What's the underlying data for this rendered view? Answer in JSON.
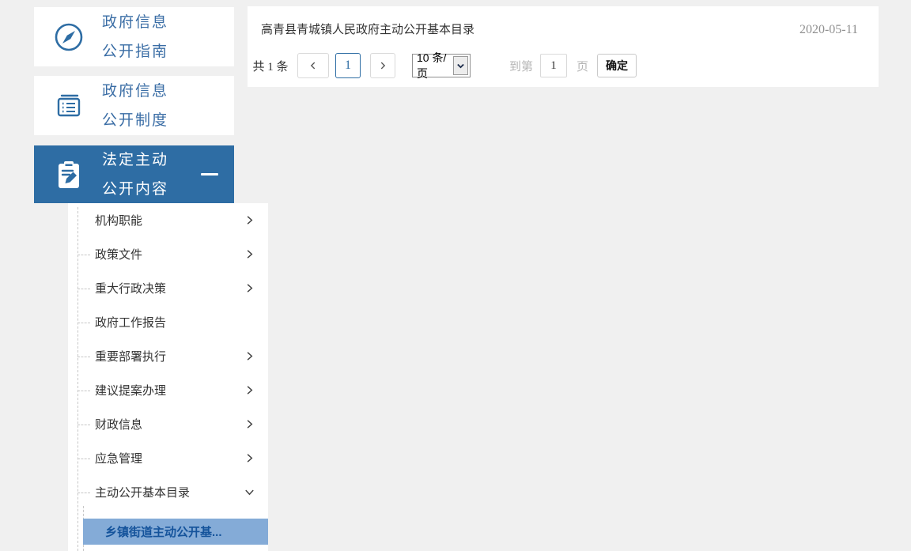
{
  "sidebar": {
    "cards": [
      {
        "icon": "compass-icon",
        "lines": [
          "政府信息",
          "公开指南"
        ],
        "active": false
      },
      {
        "icon": "notebook-icon",
        "lines": [
          "政府信息",
          "公开制度"
        ],
        "active": false
      },
      {
        "icon": "clipboard-pencil-icon",
        "lines": [
          "法定主动",
          "公开内容"
        ],
        "active": true,
        "collapse_indicator": "minus-icon"
      }
    ],
    "tree": {
      "items": [
        {
          "label": "机构职能",
          "chevron": "right"
        },
        {
          "label": "政策文件",
          "chevron": "right"
        },
        {
          "label": "重大行政决策",
          "chevron": "right"
        },
        {
          "label": "政府工作报告",
          "chevron": "none"
        },
        {
          "label": "重要部署执行",
          "chevron": "right"
        },
        {
          "label": "建议提案办理",
          "chevron": "right"
        },
        {
          "label": "财政信息",
          "chevron": "right"
        },
        {
          "label": "应急管理",
          "chevron": "right"
        },
        {
          "label": "主动公开基本目录",
          "chevron": "down"
        }
      ],
      "active_child": {
        "label": "乡镇街道主动公开基..."
      }
    }
  },
  "main": {
    "list": [
      {
        "title": "高青县青城镇人民政府主动公开基本目录",
        "date": "2020-05-11"
      }
    ],
    "pagination": {
      "total_label": "共 1 条",
      "current_page": "1",
      "page_size": "10 条/页",
      "goto_prefix": "到第",
      "goto_value": "1",
      "goto_suffix": "页",
      "confirm_label": "确定"
    }
  },
  "icons": {
    "compass-icon": "circle with NE-SW needle",
    "notebook-icon": "book with list lines",
    "clipboard-pencil-icon": "clipboard with pencil",
    "minus-icon": "—",
    "chevron-right-icon": "›",
    "chevron-down-icon": "⌄",
    "chevron-left-icon": "‹"
  },
  "colors": {
    "accent": "#2e6da4",
    "card_text": "#3a6da5",
    "highlight_bg": "#84abd7",
    "highlight_text": "#14539b",
    "page_bg": "#f0f0f0",
    "muted_text": "#b5b5b5",
    "date_text": "#8f8f8f"
  }
}
